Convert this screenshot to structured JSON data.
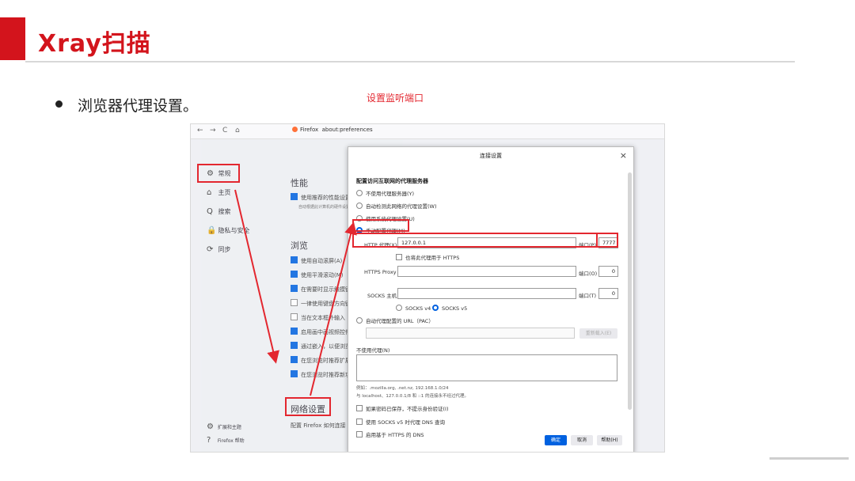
{
  "slide": {
    "title": "Xray扫描",
    "bullet": "浏览器代理设置。"
  },
  "browser": {
    "back": "←",
    "forward": "→",
    "reload": "C",
    "home": "⌂",
    "tab_label": "Firefox",
    "url": "about:preferences"
  },
  "sidebar": {
    "items": [
      {
        "icon": "gear-icon",
        "glyph": "⚙",
        "label": "常规"
      },
      {
        "icon": "home-icon",
        "glyph": "⌂",
        "label": "主页"
      },
      {
        "icon": "search-icon",
        "glyph": "Q",
        "label": "搜索"
      },
      {
        "icon": "lock-icon",
        "glyph": "🔒",
        "label": "隐私与安全"
      },
      {
        "icon": "sync-icon",
        "glyph": "⟳",
        "label": "同步"
      }
    ],
    "footer": [
      {
        "icon": "extensions-icon",
        "glyph": "⚙",
        "label": "扩展和主题"
      },
      {
        "icon": "help-icon",
        "glyph": "?",
        "label": "Firefox 帮助"
      }
    ]
  },
  "settings": {
    "perf_title": "性能",
    "perf_option": "使用推荐的性能设置",
    "perf_note": "自动根据此计算机的硬件设置最适合的性能设置",
    "browse_title": "浏览",
    "browse_options": [
      {
        "label": "使用自动滚屏(A)",
        "checked": true
      },
      {
        "label": "使用平滑滚动(M)",
        "checked": true
      },
      {
        "label": "在需要时显示触摸键盘",
        "checked": true
      },
      {
        "label": "一律使用键盘方向键",
        "checked": false
      },
      {
        "label": "当在文本框外输入",
        "checked": false
      },
      {
        "label": "启用画中画视频控件",
        "checked": true
      },
      {
        "label": "通过嵌入，以便浏览",
        "checked": true
      },
      {
        "label": "在您浏览时推荐扩展",
        "checked": true
      },
      {
        "label": "在您浏览时推荐新功能",
        "checked": true
      }
    ],
    "network_title": "网络设置",
    "network_desc": "配置 Firefox 如何连接"
  },
  "dialog": {
    "title": "连接设置",
    "close": "×",
    "heading": "配置访问互联网的代理服务器",
    "radios": [
      {
        "label": "不使用代理服务器(Y)",
        "selected": false
      },
      {
        "label": "自动检测此网络的代理设置(W)",
        "selected": false
      },
      {
        "label": "使用系统代理设置(U)",
        "selected": false
      },
      {
        "label": "手动配置代理(M)",
        "selected": true
      }
    ],
    "http_label": "HTTP 代理(X)",
    "http_value": "127.0.0.1",
    "port_label": "端口(P)",
    "http_port": "7777",
    "also_https": "也将此代理用于 HTTPS",
    "https_label": "HTTPS Proxy",
    "https_port_label": "端口(O)",
    "https_port": "0",
    "socks_label": "SOCKS 主机",
    "socks_port_label": "端口(T)",
    "socks_port": "0",
    "socks_v4": "SOCKS v4",
    "socks_v5": "SOCKS v5",
    "auto_url_label": "自动代理配置的 URL（PAC）",
    "reload_btn": "重新载入(E)",
    "no_proxy_label": "不使用代理(N)",
    "example_line1": "例如：.mozilla.org, .net.nz, 192.168.1.0/24",
    "example_line2": "与 localhost、127.0.0.1/8 和 ::1 的连接永不经过代理。",
    "check1": "如果密码已保存，不提示身份验证(I)",
    "check2": "使用 SOCKS v5 时代理 DNS 查询",
    "check3": "启用基于 HTTPS 的 DNS",
    "ok": "确定",
    "cancel": "取消",
    "help": "帮助(H)"
  },
  "annotation": {
    "text": "设置监听端口",
    "color": "#e3272f"
  }
}
